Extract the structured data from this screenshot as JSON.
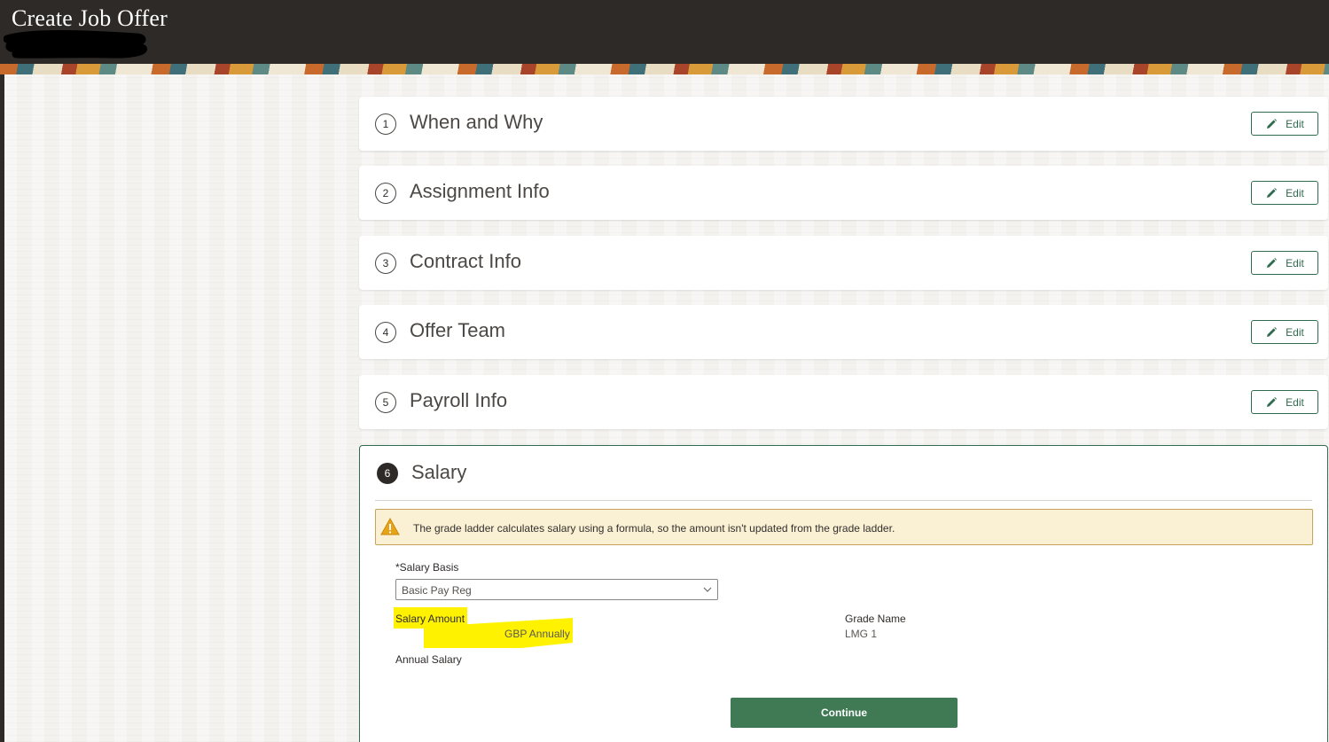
{
  "header": {
    "title": "Create Job Offer"
  },
  "sections": [
    {
      "number": "1",
      "title": "When and Why",
      "edit_label": "Edit"
    },
    {
      "number": "2",
      "title": "Assignment Info",
      "edit_label": "Edit"
    },
    {
      "number": "3",
      "title": "Contract Info",
      "edit_label": "Edit"
    },
    {
      "number": "4",
      "title": "Offer Team",
      "edit_label": "Edit"
    },
    {
      "number": "5",
      "title": "Payroll Info",
      "edit_label": "Edit"
    }
  ],
  "salary": {
    "number": "6",
    "title": "Salary",
    "warning": "The grade ladder calculates salary using a formula, so the amount isn't updated from the grade ladder.",
    "salary_basis_required": "*",
    "salary_basis_label": "Salary Basis",
    "salary_basis_value": "Basic Pay Reg",
    "salary_amount_label": "Salary Amount",
    "salary_amount_unit": "GBP Annually",
    "annual_salary_label": "Annual Salary",
    "grade_name_label": "Grade Name",
    "grade_name_value": "LMG 1",
    "continue_label": "Continue"
  },
  "icons": {
    "edit": "pencil-icon",
    "warning": "warning-triangle-icon",
    "dropdown": "chevron-down-icon"
  },
  "colors": {
    "header_bg": "#2e2a27",
    "accent_green": "#2f6b4f",
    "continue_bg": "#3f7a55",
    "warning_bg": "#faf0d4",
    "highlight": "#fff200"
  }
}
